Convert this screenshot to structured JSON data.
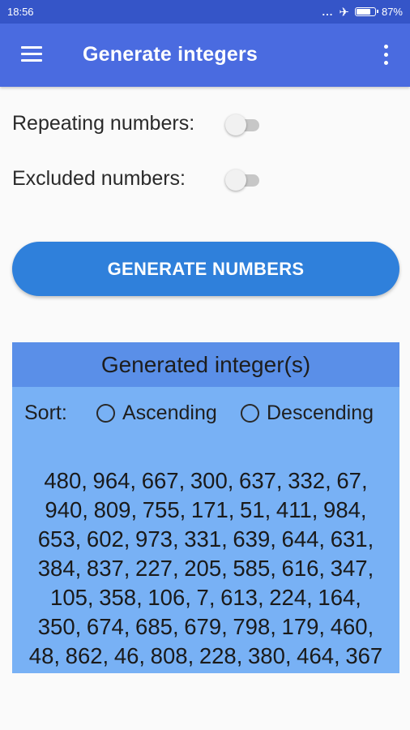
{
  "status_bar": {
    "time": "18:56",
    "dots": "...",
    "airplane_icon": "airplane-icon",
    "battery_percent": "87%",
    "battery_level": 0.87
  },
  "app_bar": {
    "title": "Generate integers",
    "menu_icon": "hamburger-menu-icon",
    "overflow_icon": "more-vert-icon"
  },
  "options": {
    "repeating_label": "Repeating numbers:",
    "repeating_on": false,
    "excluded_label": "Excluded numbers:",
    "excluded_on": false
  },
  "generate_button": {
    "label": "GENERATE NUMBERS"
  },
  "result": {
    "header": "Generated integer(s)",
    "sort_label": "Sort:",
    "ascending_label": "Ascending",
    "descending_label": "Descending",
    "lines": [
      "480, 964, 667, 300, 637, 332, 67,",
      "940, 809, 755, 171, 51, 411, 984,",
      "653, 602, 973, 331, 639, 644, 631,",
      "384, 837, 227, 205, 585, 616, 347,",
      "105, 358, 106, 7, 613, 224, 164,",
      "350, 674, 685, 679, 798, 179, 460,",
      "48, 862, 46, 808, 228, 380, 464, 367"
    ]
  },
  "colors": {
    "status_bar": "#3555c8",
    "app_bar": "#4a6be0",
    "button": "#2f80db",
    "panel": "#78b1f5",
    "panel_header": "#5a8fe8"
  }
}
